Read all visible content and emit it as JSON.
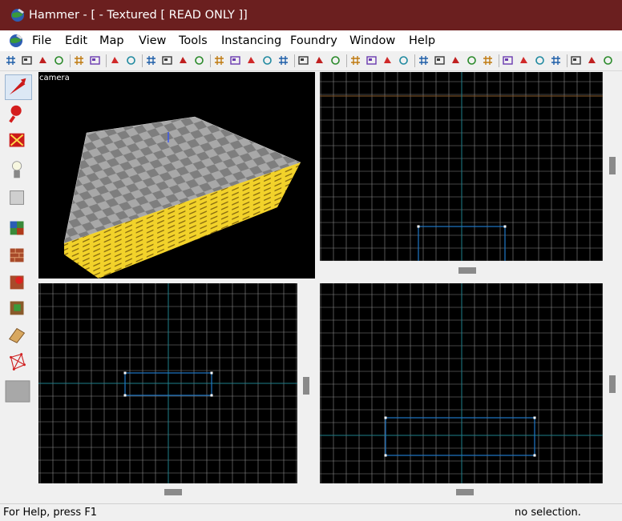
{
  "window": {
    "title": "Hammer - [ - Textured [ READ ONLY ]]"
  },
  "menu": {
    "items": [
      {
        "label": "File"
      },
      {
        "label": "Edit"
      },
      {
        "label": "Map"
      },
      {
        "label": "View"
      },
      {
        "label": "Tools"
      },
      {
        "label": "Instancing"
      },
      {
        "label": "Foundry"
      },
      {
        "label": "Window"
      },
      {
        "label": "Help"
      }
    ]
  },
  "toolbar": {
    "icons": [
      "grid-icon",
      "grid-toggle-icon",
      "grid-smaller-icon",
      "grid-larger-icon",
      "carve-icon",
      "group-icon",
      "undo-icon",
      "redo-icon",
      "hide-icon",
      "texture-lock-icon",
      "texture-apply-icon",
      "ignore-groups-icon",
      "cordon-icon",
      "cordon-toggle-icon",
      "vis-icon",
      "vis2-icon",
      "vis3-icon",
      "cut-icon",
      "copy-icon",
      "paste-icon",
      "solid-icon",
      "overlay-icon",
      "quick-hide-icon",
      "radius-icon",
      "selection-box-icon",
      "selection-mode-icon",
      "toggle-bounds-icon",
      "toggle-helpers-icon",
      "toggle-models-icon",
      "decal-icon",
      "flip-x-icon",
      "flip-y-icon",
      "flip-z-icon",
      "compile-icon",
      "world-icon",
      "texture-browser-icon"
    ]
  },
  "tools": {
    "items": [
      {
        "name": "selection-tool-icon",
        "selected": true
      },
      {
        "name": "magnify-tool-icon",
        "selected": false
      },
      {
        "name": "camera-tool-icon",
        "selected": false
      },
      {
        "name": "entity-tool-icon",
        "selected": false
      },
      {
        "name": "block-tool-icon",
        "selected": false
      },
      {
        "name": "texture-application-icon",
        "selected": false
      },
      {
        "name": "apply-current-texture-icon",
        "selected": false
      },
      {
        "name": "decal-tool-icon",
        "selected": false
      },
      {
        "name": "overlay-tool-icon",
        "selected": false
      },
      {
        "name": "clipping-tool-icon",
        "selected": false
      },
      {
        "name": "vertex-tool-icon",
        "selected": false
      },
      {
        "name": "current-texture-swatch-icon",
        "selected": false
      }
    ]
  },
  "viewports": {
    "camera_label": "camera"
  },
  "status": {
    "help_text": "For Help, press F1",
    "selection_text": "no selection."
  },
  "colors": {
    "titlebar": "#6b1f1f",
    "grid_line": "#8a8a8a",
    "grid_axis": "#1e7f8c",
    "brush_outline": "#1e78c8",
    "brush_side": "#f2d22a",
    "checker_light": "#a8a8a8",
    "checker_dark": "#7e7e7e"
  }
}
